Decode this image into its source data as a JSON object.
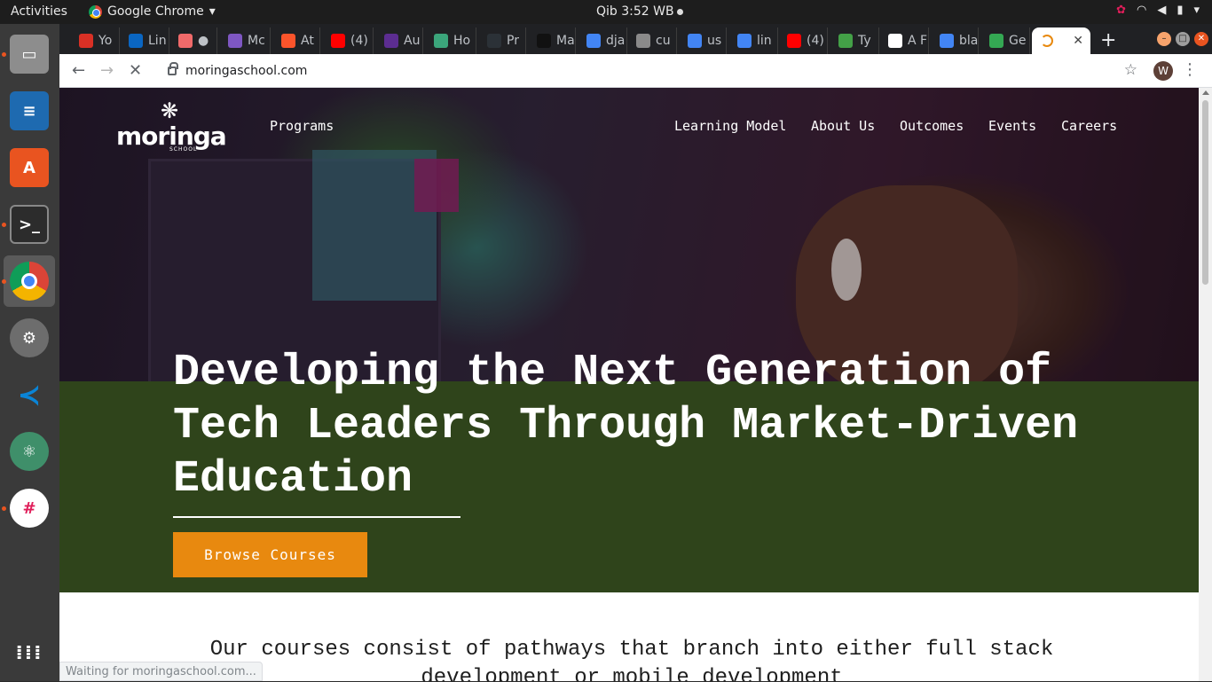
{
  "system_bar": {
    "activities": "Activities",
    "app_name": "Google Chrome",
    "clock": "Qib  3:52 WB"
  },
  "dock": {
    "items": [
      "files",
      "writer",
      "software-center",
      "terminal",
      "chrome",
      "settings",
      "vscode",
      "atom",
      "slack",
      "show-apps"
    ]
  },
  "browser": {
    "tabs": [
      {
        "label": "Yo",
        "icon": "gmail-icon",
        "color": "#d93025"
      },
      {
        "label": "Lin",
        "icon": "linkedin-icon",
        "color": "#0a66c2"
      },
      {
        "label": "●",
        "icon": "asana-icon",
        "color": "#f06a6a"
      },
      {
        "label": "Mc",
        "icon": "docs-icon",
        "color": "#7e57c2"
      },
      {
        "label": "At",
        "icon": "brave-icon",
        "color": "#fb542b"
      },
      {
        "label": "(4)",
        "icon": "youtube-icon",
        "color": "#ff0000"
      },
      {
        "label": "Au",
        "icon": "drop-icon",
        "color": "#5c2d91"
      },
      {
        "label": "Ho",
        "icon": "heroku-icon",
        "color": "#3ba57b"
      },
      {
        "label": "Pr",
        "icon": "github-icon",
        "color": "#2b3137"
      },
      {
        "label": "Ma",
        "icon": "mask-icon",
        "color": "#111111"
      },
      {
        "label": "dja",
        "icon": "google-icon",
        "color": "#4285f4"
      },
      {
        "label": "cu",
        "icon": "globe-icon",
        "color": "#8a8a8a"
      },
      {
        "label": "us",
        "icon": "google-icon",
        "color": "#4285f4"
      },
      {
        "label": "lin",
        "icon": "google-icon",
        "color": "#4285f4"
      },
      {
        "label": "(4)",
        "icon": "youtube-icon",
        "color": "#ff0000"
      },
      {
        "label": "Ty",
        "icon": "bars-icon",
        "color": "#43a047"
      },
      {
        "label": "A F",
        "icon": "codepen-icon",
        "color": "#ffffff"
      },
      {
        "label": "bla",
        "icon": "google-icon",
        "color": "#4285f4"
      },
      {
        "label": "Ge",
        "icon": "chrome-icon",
        "color": "#34a853"
      },
      {
        "label": "",
        "icon": "loading-icon",
        "color": "#e8890f",
        "active": true
      }
    ],
    "url": "moringaschool.com",
    "profile_initial": "W",
    "status": "Waiting for moringaschool.com..."
  },
  "site": {
    "logo_text": "moringa",
    "logo_sub": "SCHOOL",
    "nav": {
      "programs": "Programs",
      "learning_model": "Learning Model",
      "about_us": "About Us",
      "outcomes": "Outcomes",
      "events": "Events",
      "careers": "Careers"
    },
    "headline": "Developing the Next Generation of Tech Leaders Through Market-Driven Education",
    "cta": "Browse Courses",
    "intro": "Our courses consist of pathways that branch into either full stack development or mobile development",
    "colors": {
      "hero_green": "#2f441b",
      "cta_orange": "#e8890f"
    }
  }
}
